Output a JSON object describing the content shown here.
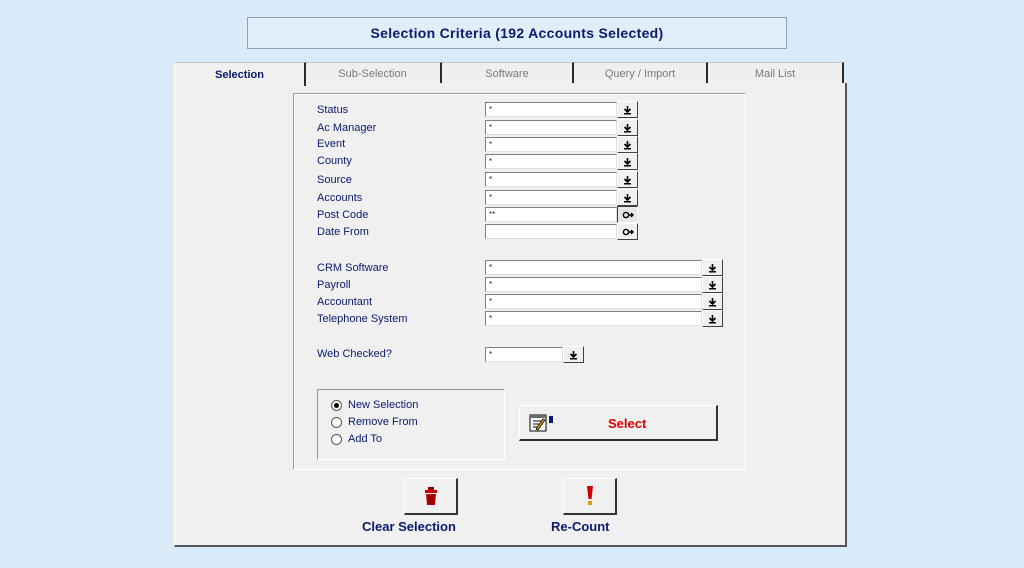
{
  "header": {
    "title": "Selection Criteria (192 Accounts Selected)"
  },
  "tabs": [
    {
      "label": "Selection",
      "active": true
    },
    {
      "label": "Sub-Selection",
      "active": false
    },
    {
      "label": "Software",
      "active": false
    },
    {
      "label": "Query / Import",
      "active": false
    },
    {
      "label": "Mail List",
      "active": false
    }
  ],
  "fields": [
    {
      "label": "Status",
      "value": "*"
    },
    {
      "label": "Ac Manager",
      "value": "*"
    },
    {
      "label": "Event",
      "value": "*"
    },
    {
      "label": "County",
      "value": "*"
    },
    {
      "label": "Source",
      "value": "*"
    },
    {
      "label": "Accounts",
      "value": "*"
    },
    {
      "label": "Post Code",
      "value": "**"
    },
    {
      "label": "Date From",
      "value": ""
    }
  ],
  "software_fields": [
    {
      "label": "CRM Software",
      "value": "*"
    },
    {
      "label": "Payroll",
      "value": "*"
    },
    {
      "label": "Accountant",
      "value": "*"
    },
    {
      "label": "Telephone System",
      "value": "*"
    }
  ],
  "web_checked": {
    "label": "Web Checked?",
    "value": "*"
  },
  "options": {
    "items": [
      {
        "label": "New Selection",
        "checked": true
      },
      {
        "label": "Remove From",
        "checked": false
      },
      {
        "label": "Add To",
        "checked": false
      }
    ]
  },
  "actions": {
    "select_label": "Select",
    "clear_label": "Clear Selection",
    "recount_label": "Re-Count"
  },
  "icons": {
    "dropdown": "pick-list-icon",
    "lookup": "lookup-icon",
    "select": "notepad-icon",
    "clear": "trash-can-icon",
    "recount": "exclamation-icon"
  },
  "colors": {
    "background": "#d9ebf9",
    "label": "#0a1a6e",
    "select_text": "#e00000",
    "trash": "#c00000",
    "exclamation": "#d00000"
  }
}
